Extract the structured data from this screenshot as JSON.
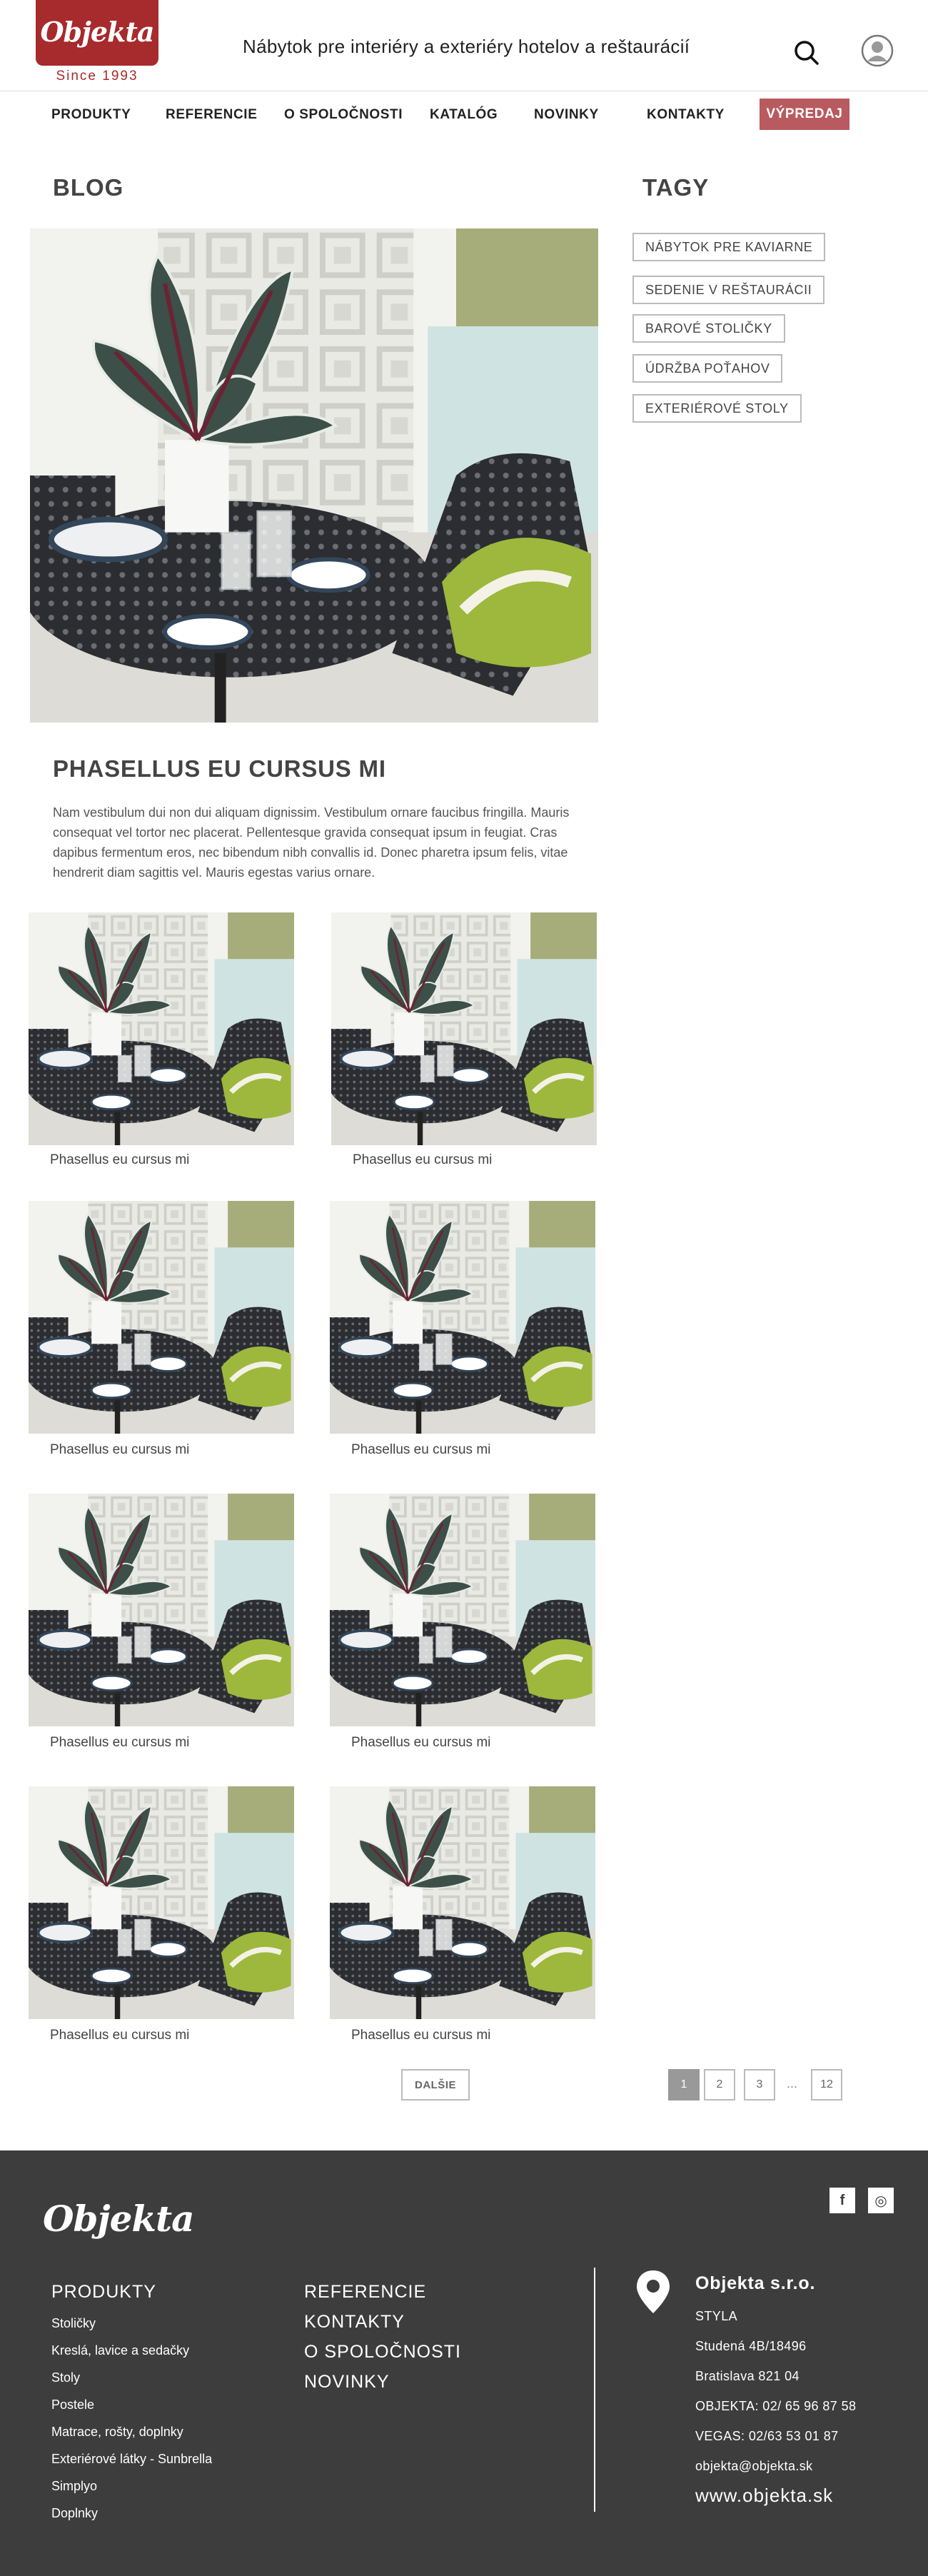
{
  "header": {
    "logo": "Objekta",
    "since": "Since 1993",
    "tagline": "Nábytok pre interiéry a exteriéry hotelov a reštaurácií"
  },
  "nav": {
    "items": [
      "PRODUKTY",
      "REFERENCIE",
      "O SPOLOČNOSTI",
      "KATALÓG",
      "NOVINKY",
      "KONTAKTY"
    ],
    "sale": "VÝPREDAJ"
  },
  "blog": {
    "title": "BLOG",
    "post_title": "PHASELLUS EU CURSUS MI",
    "post_excerpt": "Nam vestibulum dui non dui aliquam dignissim. Vestibulum ornare faucibus fringilla. Mauris consequat vel tortor nec placerat. Pellentesque gravida consequat ipsum in feugiat. Cras dapibus fermentum eros, nec bibendum nibh convallis id. Donec pharetra ipsum felis, vitae hendrerit diam sagittis vel. Mauris egestas varius ornare.",
    "thumb_captions": [
      "Phasellus eu cursus mi",
      "Phasellus eu cursus mi",
      "Phasellus eu cursus mi",
      "Phasellus eu cursus mi",
      "Phasellus eu cursus mi",
      "Phasellus eu cursus mi",
      "Phasellus eu cursus mi",
      "Phasellus eu cursus mi"
    ]
  },
  "tags": {
    "title": "TAGY",
    "items": [
      "NÁBYTOK PRE KAVIARNE",
      "SEDENIE V REŠTAURÁCII",
      "BAROVÉ STOLIČKY",
      "ÚDRŽBA POŤAHOV",
      "EXTERIÉROVÉ STOLY"
    ]
  },
  "pagination": {
    "next": "DALŠIE",
    "pages": [
      "1",
      "2",
      "3"
    ],
    "dots": "...",
    "last": "12",
    "active": "1"
  },
  "footer": {
    "logo": "Objekta",
    "social": [
      "f",
      "◎"
    ],
    "col1_head": "PRODUKTY",
    "col1_links": [
      "Stoličky",
      "Kreslá, lavice a sedačky",
      "Stoly",
      "Postele",
      "Matrace, rošty, doplnky",
      "Exteriérové látky - Sunbrella",
      "Simplyo",
      "Doplnky"
    ],
    "col2_links": [
      "REFERENCIE",
      "KONTAKTY",
      "O SPOLOČNOSTI",
      "NOVINKY"
    ],
    "company": "Objekta s.r.o.",
    "info": [
      "STYLA",
      "Studená 4B/18496",
      "Bratislava 821 04",
      "OBJEKTA: 02/ 65 96 87 58",
      "VEGAS: 02/63 53 01 87",
      "objekta@objekta.sk"
    ],
    "www": "www.objekta.sk"
  },
  "colors": {
    "brand": "#a72a2c",
    "sale": "#b85a5f",
    "footer_bg": "#3d3d3d"
  }
}
